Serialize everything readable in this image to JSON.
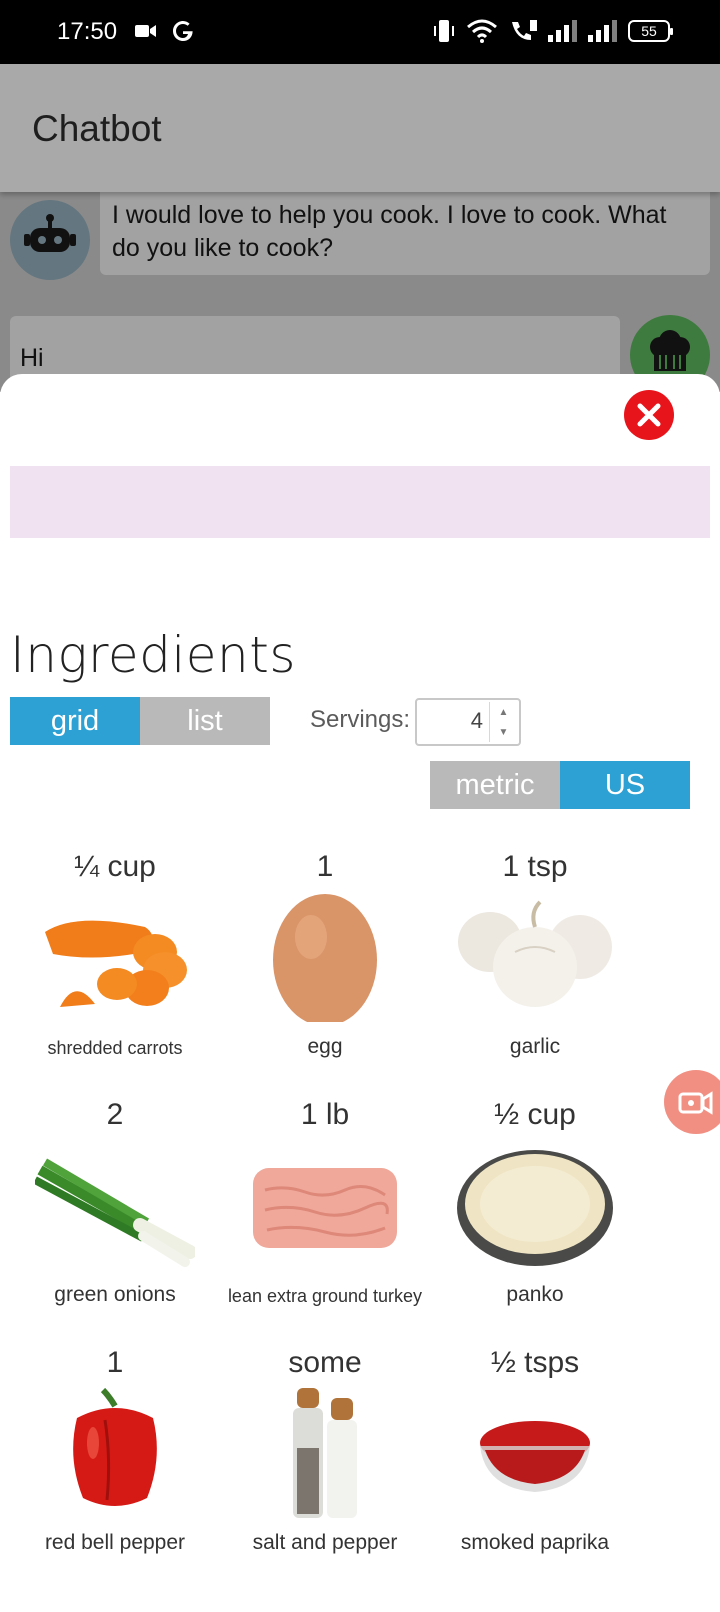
{
  "status_bar": {
    "time": "17:50",
    "battery": "55"
  },
  "app": {
    "title": "Chatbot"
  },
  "chat": {
    "bot_message": " I would love to help you cook. I love to cook. What do you like to cook?",
    "user_message": "Hi"
  },
  "sheet": {
    "title": "Ingredients",
    "view_toggle": {
      "grid": "grid",
      "list": "list",
      "selected": "grid"
    },
    "servings": {
      "label": "Servings:",
      "value": "4"
    },
    "unit_toggle": {
      "metric": "metric",
      "us": "US",
      "selected": "US"
    },
    "ingredients": [
      {
        "qty": "¼ cup",
        "name": "shredded carrots",
        "icon": "carrot-image"
      },
      {
        "qty": "1",
        "name": "egg",
        "icon": "egg-image"
      },
      {
        "qty": "1 tsp",
        "name": "garlic",
        "icon": "garlic-image"
      },
      {
        "qty": "2",
        "name": "green onions",
        "icon": "green-onion-image"
      },
      {
        "qty": "1 lb",
        "name": "lean extra ground turkey",
        "icon": "ground-turkey-image"
      },
      {
        "qty": "½ cup",
        "name": "panko",
        "icon": "panko-image"
      },
      {
        "qty": "1",
        "name": "red bell pepper",
        "icon": "bell-pepper-image"
      },
      {
        "qty": "some",
        "name": "salt and pepper",
        "icon": "salt-pepper-image"
      },
      {
        "qty": "½ tsps",
        "name": "smoked paprika",
        "icon": "paprika-image"
      }
    ]
  },
  "colors": {
    "accent": "#2ea1d4",
    "inactive": "#b9b9b9",
    "close": "#e8141c",
    "banner": "#f1e2f2"
  }
}
